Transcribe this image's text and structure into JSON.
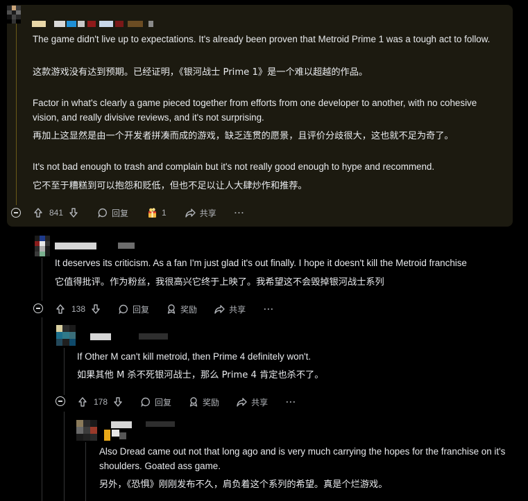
{
  "comments": [
    {
      "en_paragraphs": [
        "The game didn't live up to expectations. It's already been proven that Metroid Prime 1 was a tough act to follow.",
        "Factor in what's clearly a game pieced together from efforts from one developer to another, with no cohesive vision, and really divisive reviews, and it's not surprising.",
        "It's not bad enough to trash and complain but it's not really good enough to hype and recommend."
      ],
      "zh_paragraphs": [
        "这款游戏没有达到预期。已经证明，《银河战士 Prime 1》是一个难以超越的作品。",
        "再加上这显然是由一个开发者拼凑而成的游戏，缺乏连贯的愿景，且评价分歧很大，这也就不足为奇了。",
        "它不至于糟糕到可以抱怨和贬低，但也不足以让人大肆炒作和推荐。"
      ],
      "votes": "841",
      "reply_label": "回复",
      "award_count": "1",
      "share_label": "共享",
      "more_label": "···"
    },
    {
      "en": "It deserves its criticism. As a fan I'm just glad it's out finally. I hope it doesn't kill the Metroid franchise",
      "zh": "它值得批评。作为粉丝，我很高兴它终于上映了。我希望这不会毁掉银河战士系列",
      "votes": "138",
      "reply_label": "回复",
      "award_label": "奖励",
      "share_label": "共享",
      "more_label": "···"
    },
    {
      "en": "If Other M can't kill metroid, then Prime 4 definitely won't.",
      "zh": "如果其他 M 杀不死银河战士，那么 Prime 4 肯定也杀不了。",
      "votes": "178",
      "reply_label": "回复",
      "award_label": "奖励",
      "share_label": "共享",
      "more_label": "···"
    },
    {
      "en": "Also Dread came out not that long ago and is very much carrying the hopes for the franchise on it's shoulders. Goated ass game.",
      "zh": "另外，《恐惧》刚刚发布不久，肩负着这个系列的希望。真是个烂游戏。"
    }
  ],
  "icons": {
    "upvote": "arrow-up-icon",
    "downvote": "arrow-down-icon",
    "reply": "speech-bubble-icon",
    "award": "award-icon",
    "share": "share-arrow-icon",
    "collapse": "collapse-minus-icon"
  },
  "colors": {
    "background": "#000000",
    "highlight": "#1c1a10",
    "text": "#e8eaed",
    "muted": "#b0b3b8",
    "thread_line": "#343536"
  }
}
